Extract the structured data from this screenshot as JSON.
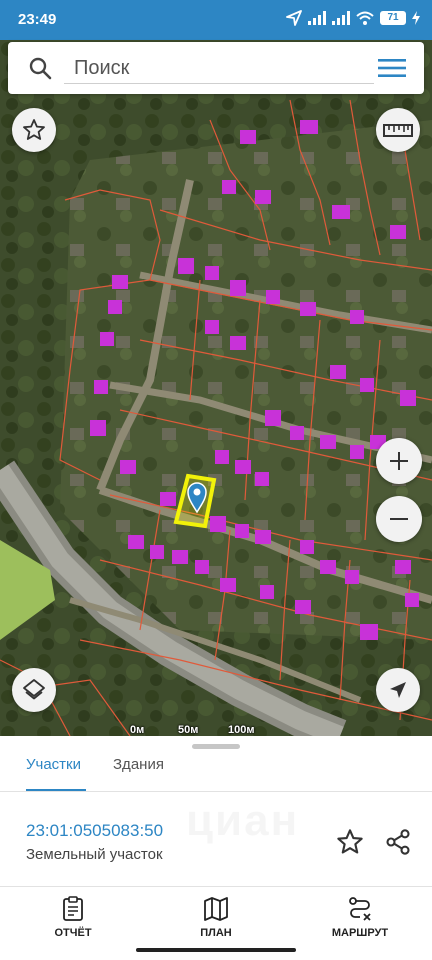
{
  "status_bar": {
    "time": "23:49",
    "battery_percent": "71",
    "icons": [
      "location-arrow-icon",
      "signal-icon",
      "signal-icon",
      "wifi-icon",
      "battery-icon",
      "charging-icon"
    ]
  },
  "search": {
    "placeholder": "Поиск",
    "icon": "search-icon",
    "menu_icon": "hamburger-menu-icon"
  },
  "map": {
    "scale_labels": [
      "0м",
      "50м",
      "100м"
    ],
    "controls": [
      "favorite-star-icon",
      "ruler-icon",
      "zoom-in-icon",
      "zoom-out-icon",
      "layers-icon",
      "navigation-arrow-icon"
    ],
    "colors": {
      "parcel_outline": "#e05a3a",
      "building_fill": "#c832d8",
      "selected_parcel": "#f2f20a",
      "marker": "#2d86c4"
    }
  },
  "sheet": {
    "tabs": [
      {
        "label": "Участки",
        "active": true
      },
      {
        "label": "Здания",
        "active": false
      }
    ],
    "parcel_number": "23:01:0505083:50",
    "parcel_type": "Земельный участок",
    "watermark": "циан"
  },
  "bottom_nav": [
    {
      "label": "ОТЧЁТ",
      "icon": "clipboard-report-icon"
    },
    {
      "label": "ПЛАН",
      "icon": "map-plan-icon"
    },
    {
      "label": "МАРШРУТ",
      "icon": "route-icon"
    }
  ],
  "colors": {
    "accent": "#2d86c4"
  }
}
